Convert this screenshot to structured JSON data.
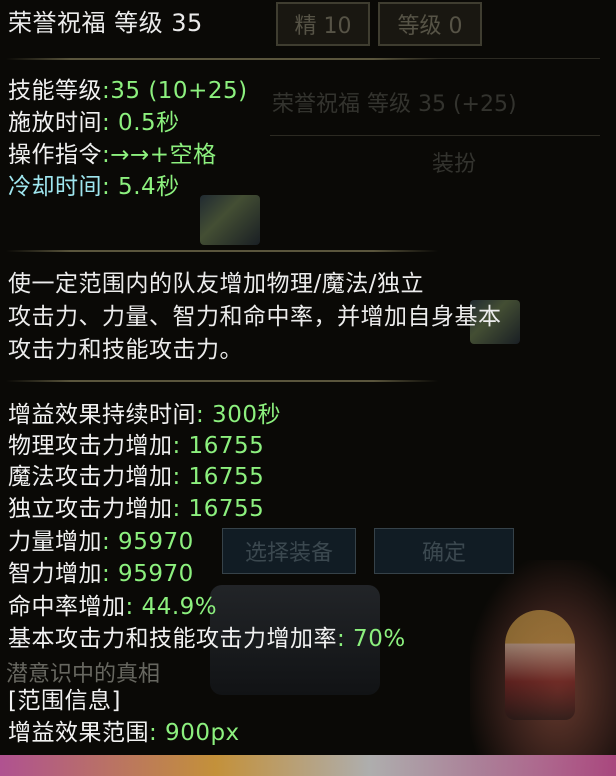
{
  "background": {
    "tab_jing": "精 10",
    "tab_level": "等级 0",
    "skill_heading": "荣誉祝福 等级 35 (+25)",
    "dressup": "装扮",
    "select_equipment_button": "选择装备",
    "confirm_button": "确定",
    "partial_text": "潜意识中的真相"
  },
  "tooltip": {
    "title": "荣誉祝福 等级 35",
    "skill_level": {
      "label": "技能等级",
      "value": ":35 (10+25)"
    },
    "cast_time": {
      "label": "施放时间",
      "value": ": 0.5秒"
    },
    "command": {
      "label": "操作指令",
      "value": ":→→+空格"
    },
    "cooldown": {
      "label": "冷却时间",
      "value": ": 5.4秒"
    },
    "description": [
      "    使一定范围内的队友增加物理/魔法/独立",
      "攻击力、力量、智力和命中率，并增加自身基本",
      "攻击力和技能攻击力。"
    ],
    "stats": [
      {
        "label": "增益效果持续时间",
        "value": ": 300秒"
      },
      {
        "label": "物理攻击力增加",
        "value": ": 16755"
      },
      {
        "label": "魔法攻击力增加",
        "value": ": 16755"
      },
      {
        "label": "独立攻击力增加",
        "value": ": 16755"
      },
      {
        "label": "力量增加",
        "value": ": 95970"
      },
      {
        "label": "智力增加",
        "value": ": 95970"
      },
      {
        "label": "命中率增加",
        "value": ": 44.9%"
      },
      {
        "label": "基本攻击力和技能攻击力增加率",
        "value": ": 70%"
      }
    ],
    "range_header": "[范围信息]",
    "range": {
      "label": "增益效果范围",
      "value": ": 900px"
    }
  },
  "colors": {
    "label": "#f1f1f1",
    "value": "#8cf07e",
    "cooldown_label": "#9fe6ef",
    "background": "#0a0906"
  }
}
